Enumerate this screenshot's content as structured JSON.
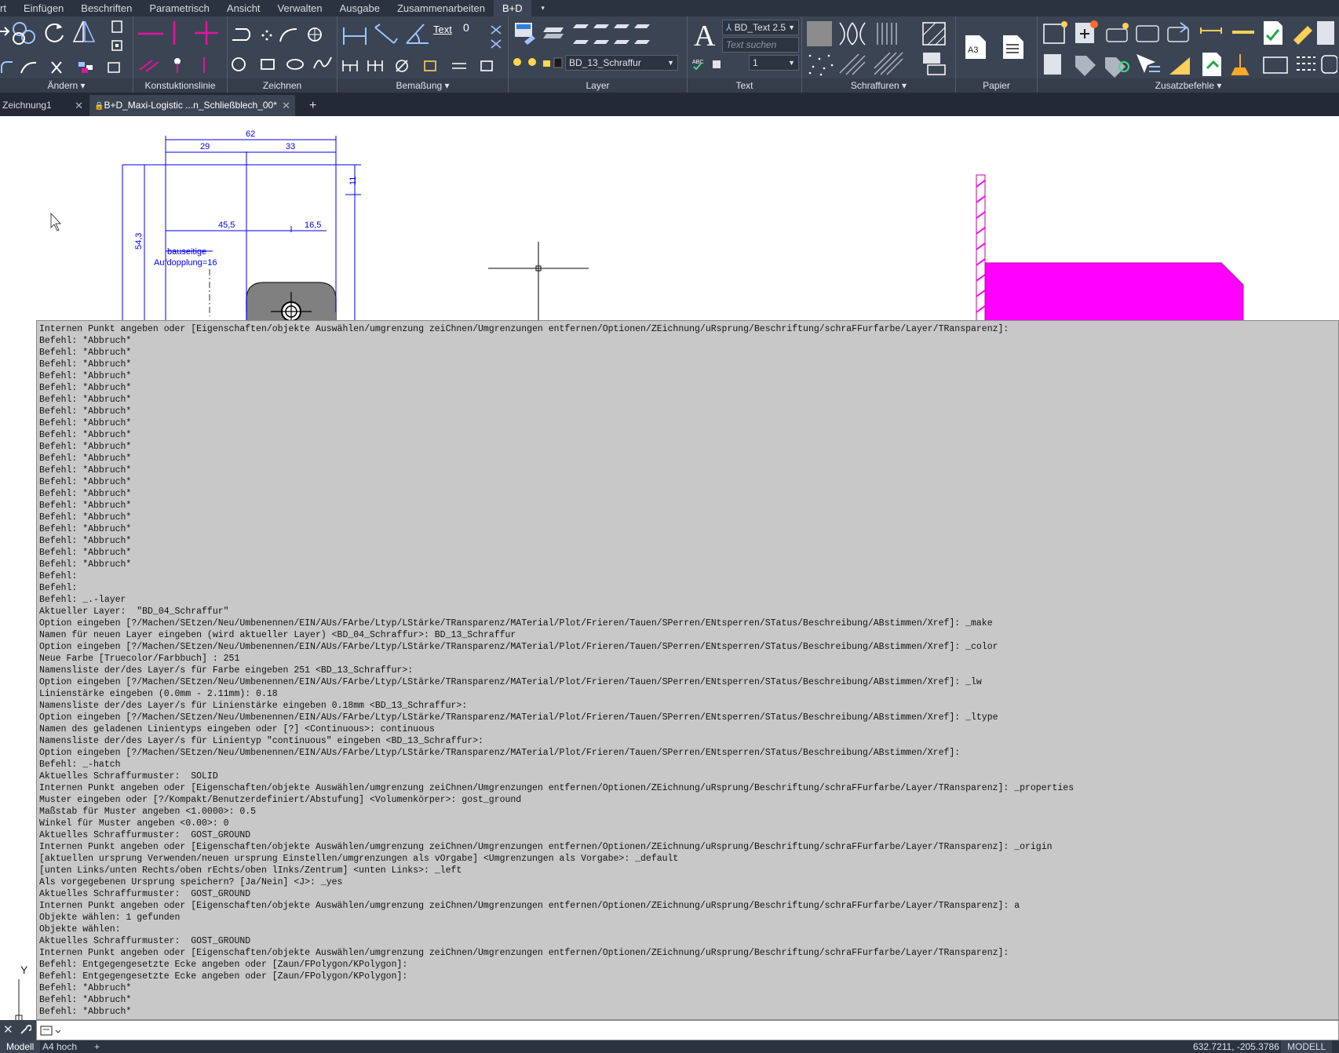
{
  "menubar": {
    "items": [
      "rt",
      "Einfügen",
      "Beschriften",
      "Parametrisch",
      "Ansicht",
      "Verwalten",
      "Ausgabe",
      "Zusammenarbeiten",
      "B+D"
    ],
    "active_index": 8,
    "extra": "▾"
  },
  "ribbon": {
    "panels": [
      "Ändern ▾",
      "Konstuktionslinie",
      "Zeichnen",
      "Bemaßung ▾",
      "Layer",
      "Text",
      "Schraffuren ▾",
      "Papier",
      "Zusatzbefehle ▾"
    ],
    "text_style": "BD_Text 2.5",
    "text_search_placeholder": "Text suchen",
    "text_height": "1",
    "layer_name": "BD_13_Schraffur",
    "bem_text_label": "Text",
    "paper_label": "A3",
    "accent_magenta": "#e6129f"
  },
  "tabs": [
    {
      "label": "Zeichnung1"
    },
    {
      "label": "B+D_Maxi-Logistic ...n_Schließblech_00*"
    }
  ],
  "drawing": {
    "dims": {
      "d62": "62",
      "d29": "29",
      "d33": "33",
      "d11": "11",
      "d54": "54,3",
      "d45": "45,5",
      "d16": "16,5"
    },
    "note1": "bauseitige",
    "note2": "Aufdopplung=16",
    "hatch_color": "#ff00ff",
    "part_color": "#808080",
    "dim_color": "#0000ee"
  },
  "command": {
    "history": [
      "Internen Punkt angeben oder [Eigenschaften/objekte Auswählen/umgrenzung zeiChnen/Umgrenzungen entfernen/Optionen/ZEichnung/uRsprung/Beschriftung/schraFFurfarbe/Layer/TRansparenz]:",
      "Befehl: *Abbruch*",
      "Befehl: *Abbruch*",
      "Befehl: *Abbruch*",
      "Befehl: *Abbruch*",
      "Befehl: *Abbruch*",
      "Befehl: *Abbruch*",
      "Befehl: *Abbruch*",
      "Befehl: *Abbruch*",
      "Befehl: *Abbruch*",
      "Befehl: *Abbruch*",
      "Befehl: *Abbruch*",
      "Befehl: *Abbruch*",
      "Befehl: *Abbruch*",
      "Befehl: *Abbruch*",
      "Befehl: *Abbruch*",
      "Befehl: *Abbruch*",
      "Befehl: *Abbruch*",
      "Befehl: *Abbruch*",
      "Befehl: *Abbruch*",
      "Befehl: *Abbruch*",
      "Befehl:",
      "Befehl:",
      "Befehl: _.-layer",
      "Aktueller Layer:  \"BD_04_Schraffur\"",
      "Option eingeben [?/Machen/SEtzen/Neu/Umbenennen/EIN/AUs/FArbe/Ltyp/LStärke/TRansparenz/MATerial/Plot/Frieren/Tauen/SPerren/ENtsperren/STatus/Beschreibung/ABstimmen/Xref]: _make",
      "Namen für neuen Layer eingeben (wird aktueller Layer) <BD_04_Schraffur>: BD_13_Schraffur",
      "Option eingeben [?/Machen/SEtzen/Neu/Umbenennen/EIN/AUs/FArbe/Ltyp/LStärke/TRansparenz/MATerial/Plot/Frieren/Tauen/SPerren/ENtsperren/STatus/Beschreibung/ABstimmen/Xref]: _color",
      "Neue Farbe [Truecolor/Farbbuch] : 251",
      "Namensliste der/des Layer/s für Farbe eingeben 251 <BD_13_Schraffur>:",
      "Option eingeben [?/Machen/SEtzen/Neu/Umbenennen/EIN/AUs/FArbe/Ltyp/LStärke/TRansparenz/MATerial/Plot/Frieren/Tauen/SPerren/ENtsperren/STatus/Beschreibung/ABstimmen/Xref]: _lw",
      "Linienstärke eingeben (0.0mm - 2.11mm): 0.18",
      "Namensliste der/des Layer/s für Linienstärke eingeben 0.18mm <BD_13_Schraffur>:",
      "Option eingeben [?/Machen/SEtzen/Neu/Umbenennen/EIN/AUs/FArbe/Ltyp/LStärke/TRansparenz/MATerial/Plot/Frieren/Tauen/SPerren/ENtsperren/STatus/Beschreibung/ABstimmen/Xref]: _ltype",
      "Namen des geladenen Linientyps eingeben oder [?] <Continuous>: continuous",
      "Namensliste der/des Layer/s für Linientyp \"continuous\" eingeben <BD_13_Schraffur>:",
      "Option eingeben [?/Machen/SEtzen/Neu/Umbenennen/EIN/AUs/FArbe/Ltyp/LStärke/TRansparenz/MATerial/Plot/Frieren/Tauen/SPerren/ENtsperren/STatus/Beschreibung/ABstimmen/Xref]:",
      "Befehl: _-hatch",
      "Aktuelles Schraffurmuster:  SOLID",
      "Internen Punkt angeben oder [Eigenschaften/objekte Auswählen/umgrenzung zeiChnen/Umgrenzungen entfernen/Optionen/ZEichnung/uRsprung/Beschriftung/schraFFurfarbe/Layer/TRansparenz]: _properties",
      "Muster eingeben oder [?/Kompakt/Benutzerdefiniert/Abstufung] <Volumenkörper>: gost_ground",
      "Maßstab für Muster angeben <1.0000>: 0.5",
      "Winkel für Muster angeben <0.00>: 0",
      "Aktuelles Schraffurmuster:  GOST_GROUND",
      "Internen Punkt angeben oder [Eigenschaften/objekte Auswählen/umgrenzung zeiChnen/Umgrenzungen entfernen/Optionen/ZEichnung/uRsprung/Beschriftung/schraFFurfarbe/Layer/TRansparenz]: _origin",
      "[aktuellen ursprung Verwenden/neuen ursprung Einstellen/umgrenzungen als vOrgabe] <Umgrenzungen als Vorgabe>: _default",
      "[unten Links/unten Rechts/oben rEchts/oben lInks/Zentrum] <unten Links>: _left",
      "Als vorgegebenen Ursprung speichern? [Ja/Nein] <J>: _yes",
      "Aktuelles Schraffurmuster:  GOST_GROUND",
      "Internen Punkt angeben oder [Eigenschaften/objekte Auswählen/umgrenzung zeiChnen/Umgrenzungen entfernen/Optionen/ZEichnung/uRsprung/Beschriftung/schraFFurfarbe/Layer/TRansparenz]: a",
      "Objekte wählen: 1 gefunden",
      "Objekte wählen:",
      "Aktuelles Schraffurmuster:  GOST_GROUND",
      "Internen Punkt angeben oder [Eigenschaften/objekte Auswählen/umgrenzung zeiChnen/Umgrenzungen entfernen/Optionen/ZEichnung/uRsprung/Beschriftung/schraFFurfarbe/Layer/TRansparenz]:",
      "Befehl: Entgegengesetzte Ecke angeben oder [Zaun/FPolygon/KPolygon]:",
      "Befehl: Entgegengesetzte Ecke angeben oder [Zaun/FPolygon/KPolygon]:",
      "Befehl: *Abbruch*",
      "Befehl: *Abbruch*",
      "Befehl: *Abbruch*"
    ],
    "input_value": ""
  },
  "ucs": {
    "y": "Y"
  },
  "status": {
    "tabs": [
      "Modell",
      "A4 hoch",
      "+"
    ],
    "coords": "632.7211, -205.3786",
    "mode": "MODELL"
  }
}
